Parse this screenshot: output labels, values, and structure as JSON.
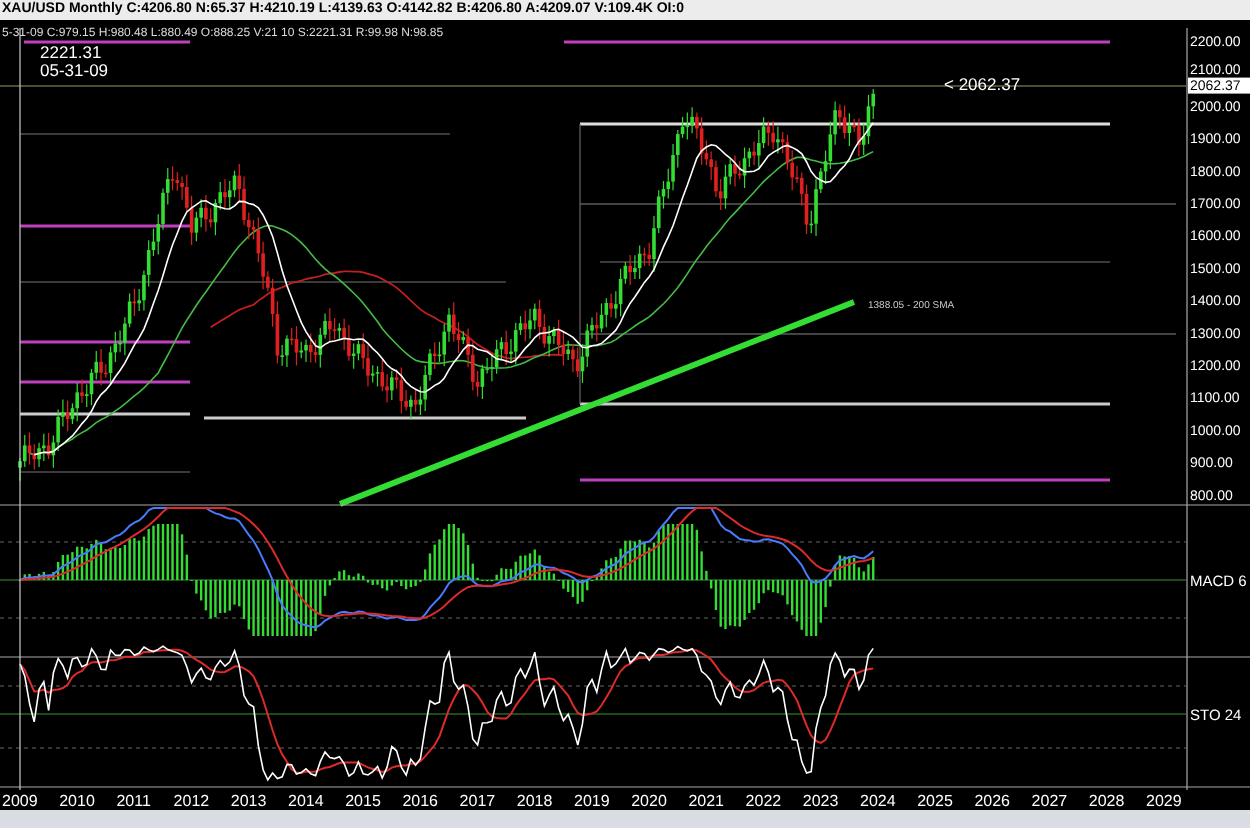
{
  "header": {
    "title": "XAU/USD Monthly C:4206.80 N:65.37 H:4210.19 L:4139.63 O:4142.82 B:4206.80 A:4209.07 V:109.4K OI:0",
    "cursor_info": "5-31-09 C:979.15 H:980.48 L:880.49 O:888.25 V:21 10 S:2221.31 R:99.98 N:98.85"
  },
  "price_pane": {
    "cursor_value": "2221.31",
    "cursor_date": "05-31-09",
    "last_price_note": "< 2062.37",
    "sma_note": "1388.05 - 200 SMA",
    "last_price_tag": "2062.37",
    "axis_ticks": [
      "2200.00",
      "2100.00",
      "2000.00",
      "1900.00",
      "1800.00",
      "1700.00",
      "1600.00",
      "1500.00",
      "1400.00",
      "1300.00",
      "1200.00",
      "1100.00",
      "1000.00",
      "900.00",
      "800.00"
    ]
  },
  "macd_pane": {
    "label": "MACD 6"
  },
  "stochastic_pane": {
    "label": "STO  24"
  },
  "time_axis": [
    "2009",
    "2010",
    "2011",
    "2012",
    "2013",
    "2014",
    "2015",
    "2016",
    "2017",
    "2018",
    "2019",
    "2020",
    "2021",
    "2022",
    "2023",
    "2024",
    "2025",
    "2026",
    "2027",
    "2028",
    "2029"
  ]
}
